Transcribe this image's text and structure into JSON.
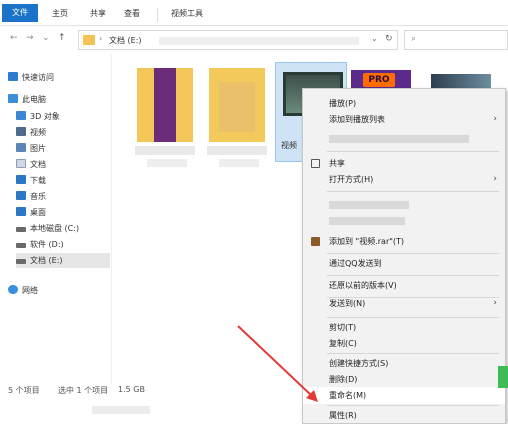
{
  "ribbon": {
    "tabs": [
      "文件",
      "主页",
      "共享",
      "查看",
      "视频工具"
    ],
    "accent_color": "#1a73c8"
  },
  "address": {
    "path": "文档 (E:)",
    "refresh_icon": "refresh-icon",
    "search_icon": "search-icon"
  },
  "sidebar": {
    "quick_access": "快速访问",
    "this_pc": "此电脑",
    "items": [
      "3D 对象",
      "视频",
      "图片",
      "文档",
      "下载",
      "音乐",
      "桌面",
      "本地磁盘 (C:)",
      "软件 (D:)",
      "文档 (E:)"
    ],
    "network": "网络"
  },
  "content": {
    "files": [
      {
        "kind": "folder-video",
        "label": "",
        "type_icon": "folder-icon"
      },
      {
        "kind": "folder",
        "label": "",
        "type_icon": "folder-icon"
      },
      {
        "kind": "video",
        "label": "视频",
        "type_icon": "video-icon"
      },
      {
        "kind": "premiere",
        "label": "",
        "badge": "PRO",
        "type_icon": "premiere-icon"
      },
      {
        "kind": "video",
        "label": "",
        "type_icon": "video-icon"
      }
    ]
  },
  "status": {
    "count": "5 个项目",
    "selected": "选中 1 个项目",
    "size": "1.5 GB"
  },
  "context_menu": {
    "items": [
      {
        "label": "播放(P)",
        "submenu": false
      },
      {
        "label": "添加到播放列表",
        "submenu": true
      },
      {
        "label": "",
        "submenu": false,
        "blurred": true
      },
      {
        "label": "共享",
        "submenu": false,
        "icon": "share-icon"
      },
      {
        "label": "打开方式(H)",
        "submenu": true
      },
      {
        "label": "",
        "submenu": false,
        "blurred": true
      },
      {
        "label": "",
        "submenu": false,
        "blurred": true
      },
      {
        "label": "添加到 \"视频.rar\"(T)",
        "submenu": false,
        "icon": "archive-icon"
      },
      {
        "label": "通过QQ发送到",
        "submenu": false
      },
      {
        "label": "还原以前的版本(V)",
        "submenu": false
      },
      {
        "label": "发送到(N)",
        "submenu": true
      },
      {
        "label": "剪切(T)",
        "submenu": false
      },
      {
        "label": "复制(C)",
        "submenu": false
      },
      {
        "label": "创建快捷方式(S)",
        "submenu": false
      },
      {
        "label": "删除(D)",
        "submenu": false
      },
      {
        "label": "重命名(M)",
        "submenu": false,
        "highlighted": true
      },
      {
        "label": "属性(R)",
        "submenu": false
      }
    ]
  },
  "annotation": {
    "arrow_color": "#e53935",
    "target": "重命名(M)"
  }
}
